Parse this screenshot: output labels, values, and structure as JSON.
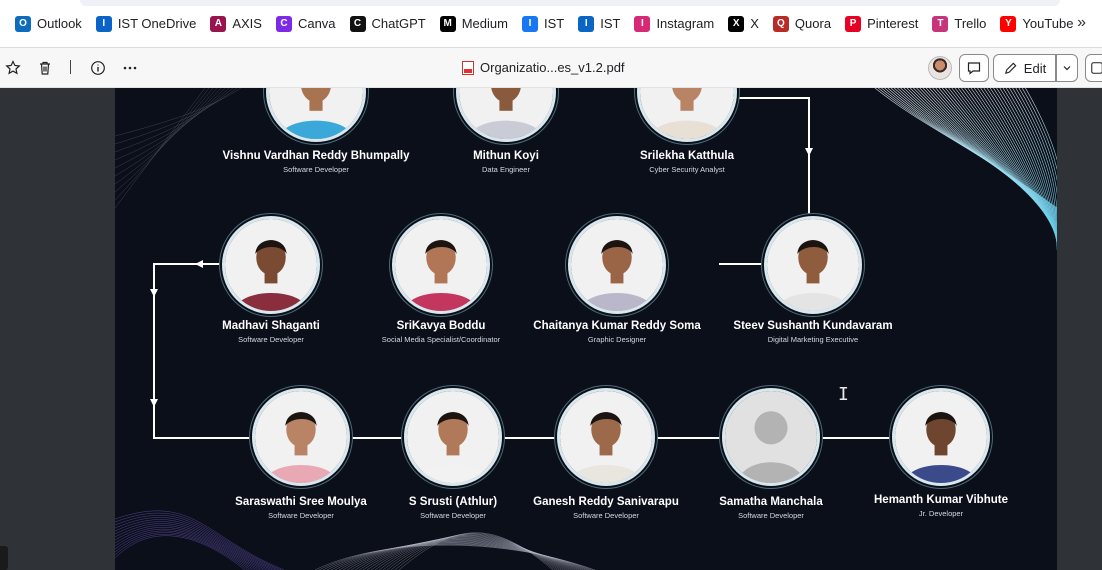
{
  "bookmarks": [
    {
      "label": "Outlook",
      "icon": "outlook-icon",
      "color": "#0f6cbd"
    },
    {
      "label": "IST OneDrive",
      "icon": "onedrive-icon",
      "color": "#0a64c8"
    },
    {
      "label": "AXIS",
      "icon": "axis-icon",
      "color": "#97144d"
    },
    {
      "label": "Canva",
      "icon": "canva-icon",
      "color": "#7d2ae8"
    },
    {
      "label": "ChatGPT",
      "icon": "chatgpt-icon",
      "color": "#111111"
    },
    {
      "label": "Medium",
      "icon": "medium-icon",
      "color": "#000000"
    },
    {
      "label": "IST",
      "icon": "facebook-icon",
      "color": "#1877f2"
    },
    {
      "label": "IST",
      "icon": "linkedin-icon",
      "color": "#0a66c2"
    },
    {
      "label": "Instagram",
      "icon": "instagram-icon",
      "color": "#d62976"
    },
    {
      "label": "X",
      "icon": "x-icon",
      "color": "#000000"
    },
    {
      "label": "Quora",
      "icon": "quora-icon",
      "color": "#b92b27"
    },
    {
      "label": "Pinterest",
      "icon": "pinterest-icon",
      "color": "#e60023"
    },
    {
      "label": "Trello",
      "icon": "trello-icon",
      "color": "#c8347a"
    },
    {
      "label": "YouTube",
      "icon": "youtube-icon",
      "color": "#ff0000"
    }
  ],
  "toolbar": {
    "document_title": "Organizatio...es_v1.2.pdf",
    "edit_label": "Edit"
  },
  "chart": {
    "people": [
      {
        "name": "Vishnu Vardhan Reddy Bhumpally",
        "role": "Software Developer",
        "shirt": "#3aa8d8",
        "skin": "#a87350"
      },
      {
        "name": "Mithun Koyi",
        "role": "Data Engineer",
        "shirt": "#c9ccd6",
        "skin": "#8a5a3c"
      },
      {
        "name": "Srilekha Katthula",
        "role": "Cyber Security Analyst",
        "shirt": "#e8dfd5",
        "skin": "#b98466"
      },
      {
        "name": "Madhavi Shaganti",
        "role": "Software Developer",
        "shirt": "#8a2e3d",
        "skin": "#7a4a33"
      },
      {
        "name": "SriKavya Boddu",
        "role": "Social Media Specialist/Coordinator",
        "shirt": "#c3375f",
        "skin": "#b07656"
      },
      {
        "name": "Chaitanya Kumar Reddy Soma",
        "role": "Graphic Designer",
        "shirt": "#b9b7c9",
        "skin": "#9a6546"
      },
      {
        "name": "Steev Sushanth Kundavaram",
        "role": "Digital Marketing Executive",
        "shirt": "#e4e4e4",
        "skin": "#8f5c3e"
      },
      {
        "name": "Saraswathi Sree Moulya",
        "role": "Software Developer",
        "shirt": "#e8a9b4",
        "skin": "#b98466"
      },
      {
        "name": "S Srusti (Athlur)",
        "role": "Software Developer",
        "shirt": "#f2f2f2",
        "skin": "#b07a5a"
      },
      {
        "name": "Ganesh Reddy Sanivarapu",
        "role": "Software Developer",
        "shirt": "#e9e6e0",
        "skin": "#9c6a4b"
      },
      {
        "name": "Samatha Manchala",
        "role": "Software Developer",
        "shirt": "placeholder",
        "skin": "placeholder"
      },
      {
        "name": "Hemanth Kumar Vibhute",
        "role": "Jr. Developer",
        "shirt": "#3b4a8a",
        "skin": "#6e4630"
      }
    ]
  }
}
